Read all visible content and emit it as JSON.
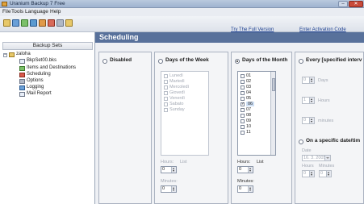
{
  "window": {
    "title": "Uranium Backup 7 Free"
  },
  "menu": [
    "File",
    "Tools",
    "Language",
    "Help"
  ],
  "toolbar": {
    "links": {
      "trial": "Try The Full Version",
      "activation": "Enter Activation Code"
    }
  },
  "sidebar": {
    "header": "Backup Sets",
    "root": "zaloha",
    "items": [
      "BkpSet00.bks",
      "Items and Destinations",
      "Scheduling",
      "Options",
      "Logging",
      "Mail Report"
    ]
  },
  "section_title": "Scheduling",
  "schedule": {
    "disabled_label": "Disabled",
    "days_of_week_label": "Days of the Week",
    "days_of_month_label": "Days of the Month",
    "every_label": "Every [specified interv",
    "specific_date_label": "On a specific date/tim",
    "selected_option": "Days of the Month",
    "weekdays": [
      "Lunedì",
      "Martedì",
      "Mercoledì",
      "Giovedì",
      "Venerdì",
      "Sabato",
      "Sunday"
    ],
    "month_days": [
      "01",
      "02",
      "03",
      "04",
      "05",
      "06",
      "07",
      "08",
      "09",
      "10",
      "11"
    ],
    "month_day_checked": "06",
    "hours_label": "Hours:",
    "minutes_label": "Minutes:",
    "list_label": "List",
    "week_hours_value": "0",
    "week_minutes_value": "0",
    "month_hours_value": "0",
    "month_minutes_value": "0",
    "interval": {
      "days_value": "0",
      "days_label": "Days",
      "hours_value": "1",
      "hours_label": "Hours",
      "minutes_value": "0",
      "minutes_label": "minutes"
    },
    "specific": {
      "date_label": "Date",
      "date_value": "16. 3. 2005",
      "hours_label": "Hours",
      "minutes_label": "Minutes",
      "hours_value": "0",
      "minutes_value": "0"
    }
  }
}
